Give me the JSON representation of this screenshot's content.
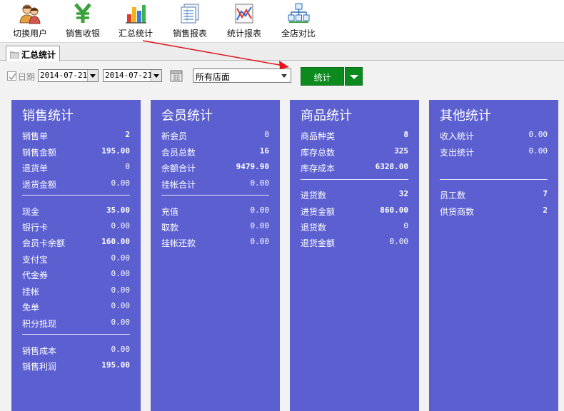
{
  "toolbar": {
    "items": [
      {
        "label": "切换用户",
        "icon": "users-icon"
      },
      {
        "label": "销售收银",
        "icon": "yen-icon"
      },
      {
        "label": "汇总统计",
        "icon": "bar-chart-icon"
      },
      {
        "label": "销售报表",
        "icon": "report-icon"
      },
      {
        "label": "统计报表",
        "icon": "line-chart-icon"
      },
      {
        "label": "全店对比",
        "icon": "network-icon"
      }
    ]
  },
  "tab": {
    "label": "汇总统计",
    "icon": "folder-icon"
  },
  "filter": {
    "date_label": "日期",
    "date_from": "2014-07-21",
    "date_to": "2014-07-21",
    "store": "所有店面",
    "run_label": "统计"
  },
  "colors": {
    "panel": "#5b5fd0",
    "run_button": "#0c8a1e",
    "arrow": "#e0151b"
  },
  "panels": {
    "sales": {
      "title": "销售统计",
      "rows": [
        {
          "label": "销售单",
          "value": "2"
        },
        {
          "label": "销售金额",
          "value": "195.00"
        },
        {
          "label": "退货单",
          "value": "0"
        },
        {
          "label": "退货金额",
          "value": "0.00"
        },
        {
          "label": "现金",
          "value": "35.00"
        },
        {
          "label": "银行卡",
          "value": "0.00"
        },
        {
          "label": "会员卡余额",
          "value": "160.00"
        },
        {
          "label": "支付宝",
          "value": "0.00"
        },
        {
          "label": "代金券",
          "value": "0.00"
        },
        {
          "label": "挂帐",
          "value": "0.00"
        },
        {
          "label": "免单",
          "value": "0.00"
        },
        {
          "label": "积分抵现",
          "value": "0.00"
        },
        {
          "label": "销售成本",
          "value": "0.00"
        },
        {
          "label": "销售利润",
          "value": "195.00"
        }
      ]
    },
    "member": {
      "title": "会员统计",
      "rows": [
        {
          "label": "新会员",
          "value": "0"
        },
        {
          "label": "会员总数",
          "value": "16"
        },
        {
          "label": "余额合计",
          "value": "9479.90"
        },
        {
          "label": "挂帐合计",
          "value": "0.00"
        },
        {
          "label": "充值",
          "value": "0.00"
        },
        {
          "label": "取款",
          "value": "0.00"
        },
        {
          "label": "挂帐还款",
          "value": "0.00"
        }
      ]
    },
    "goods": {
      "title": "商品统计",
      "rows": [
        {
          "label": "商品种类",
          "value": "8"
        },
        {
          "label": "库存总数",
          "value": "325"
        },
        {
          "label": "库存成本",
          "value": "6328.00"
        },
        {
          "label": "进货数",
          "value": "32"
        },
        {
          "label": "进货金额",
          "value": "860.00"
        },
        {
          "label": "退货数",
          "value": "0"
        },
        {
          "label": "退货金额",
          "value": "0.00"
        }
      ]
    },
    "other": {
      "title": "其他统计",
      "rows": [
        {
          "label": "收入统计",
          "value": "0.00"
        },
        {
          "label": "支出统计",
          "value": "0.00"
        },
        {
          "label": "员工数",
          "value": "7"
        },
        {
          "label": "供货商数",
          "value": "2"
        }
      ]
    }
  }
}
